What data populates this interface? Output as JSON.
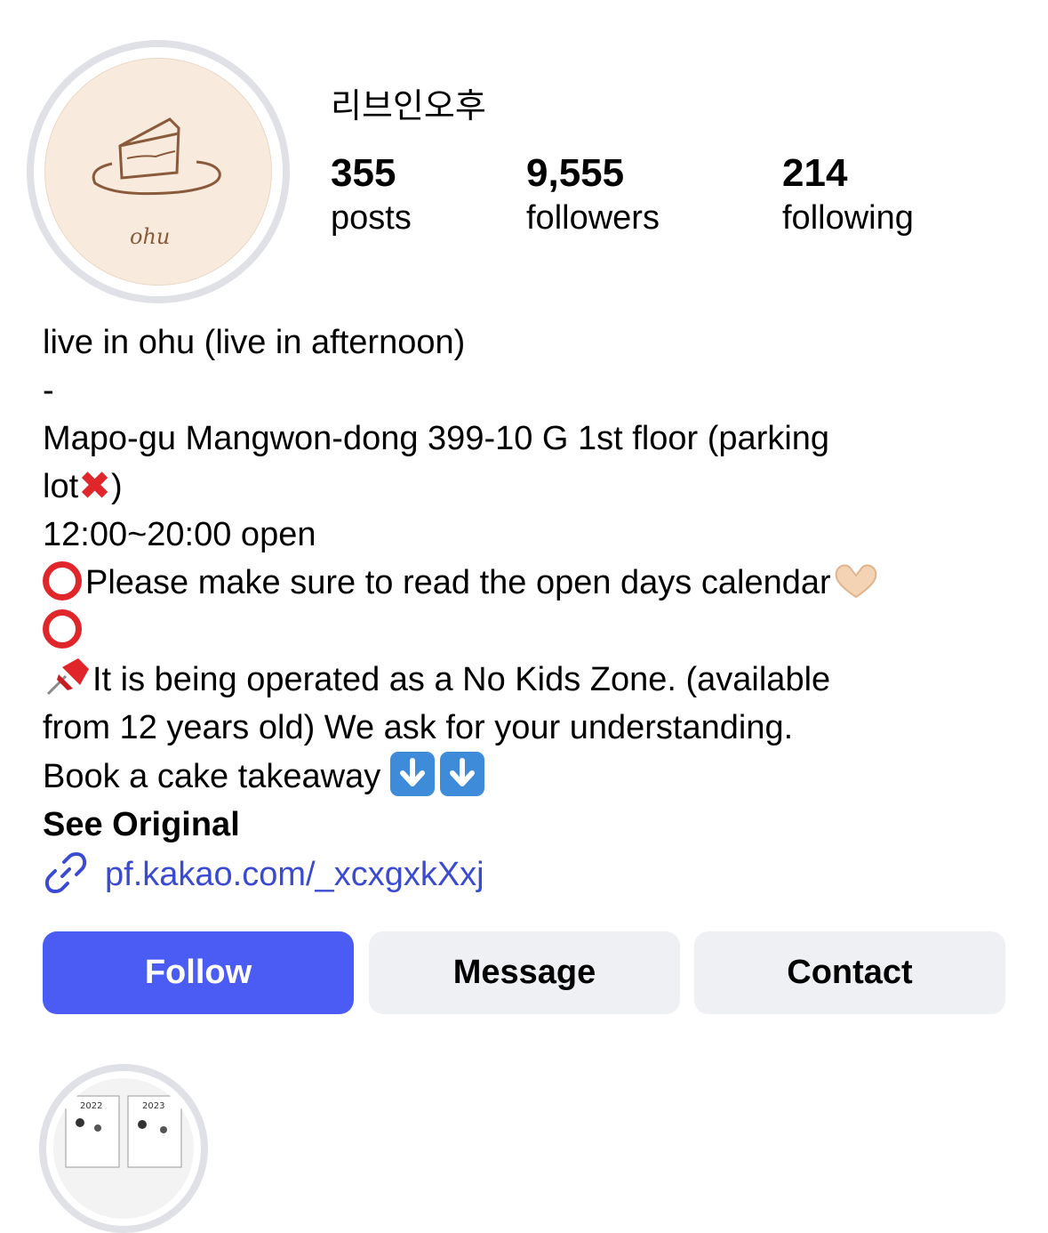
{
  "profile": {
    "username": "리브인오후",
    "avatar_text": "ohu",
    "stats": [
      {
        "value": "355",
        "label": "posts"
      },
      {
        "value": "9,555",
        "label": "followers"
      },
      {
        "value": "214",
        "label": "following"
      }
    ]
  },
  "bio": {
    "line1": "live in ohu (live in afternoon)",
    "line2": " -",
    "line3": "Mapo-gu Mangwon-dong 399-10 G 1st floor (parking",
    "line4a": "lot",
    "line4b": ")",
    "line5": " 12:00~20:00 open",
    "line6": "Please make sure to read the open days calendar",
    "line8": "It is being operated as a No Kids Zone. (available",
    "line9": "from 12 years old) We ask for your understanding.",
    "line10": "Book a cake takeaway ",
    "see_original": "See Original"
  },
  "link": {
    "text": "pf.kakao.com/_xcxgxkXxj",
    "color": "#3a4bd1"
  },
  "buttons": {
    "follow": "Follow",
    "message": "Message",
    "contact": "Contact"
  },
  "highlight": {
    "year_label_1": "2022",
    "year_label_2": "2023"
  },
  "icons": [
    "cross-mark-icon",
    "hollow-red-circle-icon",
    "heart-hands-icon",
    "pushpin-icon",
    "down-arrow-icon",
    "link-icon"
  ],
  "colors": {
    "accent": "#4b5cf5",
    "link": "#3a4bd1",
    "button_secondary": "#eff0f4",
    "avatar_bg": "#f8ebdd"
  }
}
